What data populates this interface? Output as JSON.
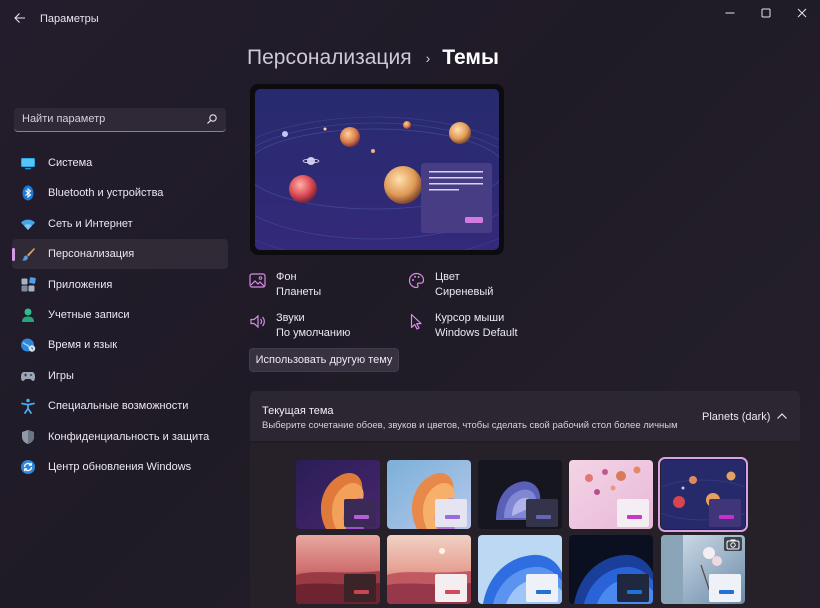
{
  "window": {
    "title": "Параметры"
  },
  "sidebar": {
    "search_placeholder": "Найти параметр",
    "items": [
      {
        "label": "Система",
        "icon": "monitor-icon"
      },
      {
        "label": "Bluetooth и устройства",
        "icon": "bluetooth-icon"
      },
      {
        "label": "Сеть и Интернет",
        "icon": "wifi-icon"
      },
      {
        "label": "Персонализация",
        "icon": "brush-icon",
        "active": true
      },
      {
        "label": "Приложения",
        "icon": "apps-icon"
      },
      {
        "label": "Учетные записи",
        "icon": "person-icon"
      },
      {
        "label": "Время и язык",
        "icon": "globe-icon"
      },
      {
        "label": "Игры",
        "icon": "gamepad-icon"
      },
      {
        "label": "Специальные возможности",
        "icon": "accessibility-icon"
      },
      {
        "label": "Конфиденциальность и защита",
        "icon": "shield-icon"
      },
      {
        "label": "Центр обновления Windows",
        "icon": "update-icon"
      }
    ]
  },
  "breadcrumb": {
    "parent": "Персонализация",
    "separator": "›",
    "current": "Темы"
  },
  "theme_props": {
    "background": {
      "label": "Фон",
      "value": "Планеты",
      "icon": "image-icon"
    },
    "color": {
      "label": "Цвет",
      "value": "Сиреневый",
      "icon": "palette-icon"
    },
    "sounds": {
      "label": "Звуки",
      "value": "По умолчанию",
      "icon": "speaker-icon"
    },
    "cursor": {
      "label": "Курсор мыши",
      "value": "Windows Default",
      "icon": "cursor-icon"
    }
  },
  "other_theme_button": "Использовать другую тему",
  "current_theme": {
    "title": "Текущая тема",
    "description": "Выберите сочетание обоев, звуков и цветов, чтобы сделать свой рабочий стол более личным",
    "value": "Planets (dark)"
  },
  "colors": {
    "accent": "#d49ae8",
    "selected_outline": "#d7a3e3"
  },
  "themes": [
    {
      "name": "theme-glow-dark",
      "accent": "#b35fd8",
      "selected": false
    },
    {
      "name": "theme-glow-light",
      "accent": "#9a6ae0",
      "selected": false
    },
    {
      "name": "theme-captured-motion",
      "accent": "#6466b8",
      "selected": false
    },
    {
      "name": "theme-flow-pink",
      "accent": "#c43ac8",
      "selected": false
    },
    {
      "name": "theme-planets-dark",
      "accent": "#c92fc9",
      "selected": true
    },
    {
      "name": "theme-sunrise-dark",
      "accent": "#c8474f",
      "selected": false
    },
    {
      "name": "theme-sunrise-light",
      "accent": "#d2475c",
      "selected": false
    },
    {
      "name": "theme-windows-light",
      "accent": "#1f72d4",
      "selected": false
    },
    {
      "name": "theme-windows-dark",
      "accent": "#1f72d4",
      "selected": false
    },
    {
      "name": "theme-spotlight",
      "accent": "#1f72d4",
      "selected": false
    }
  ]
}
